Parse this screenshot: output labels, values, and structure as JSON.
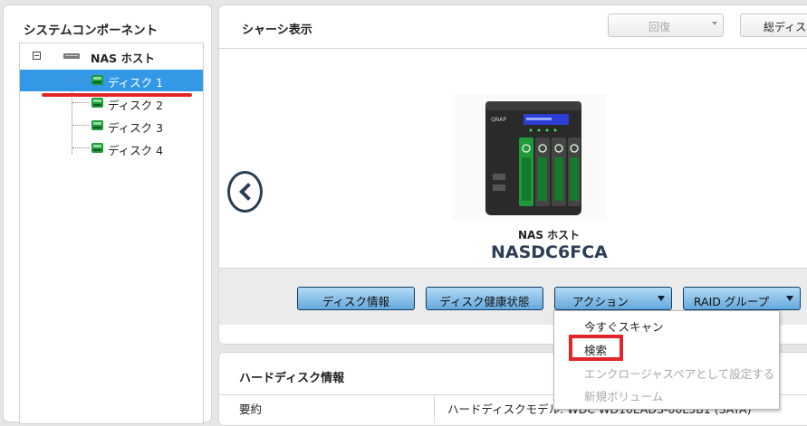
{
  "left_panel": {
    "title": "システムコンポーネント",
    "tree": {
      "root_label": "NAS ホスト",
      "items": [
        {
          "label": "ディスク 1",
          "selected": true
        },
        {
          "label": "ディスク 2",
          "selected": false
        },
        {
          "label": "ディスク 3",
          "selected": false
        },
        {
          "label": "ディスク 4",
          "selected": false
        }
      ]
    }
  },
  "chassis": {
    "title": "シャーシ表示",
    "restore_label": "回復",
    "total_label": "総ディスク",
    "nas_caption": "NAS ホスト",
    "nas_name": "NASDC6FCA"
  },
  "actions": {
    "disk_info": "ディスク情報",
    "disk_health": "ディスク健康状態",
    "action": "アクション",
    "raid_group": "RAID グループ"
  },
  "action_menu": {
    "items": [
      {
        "label": "今すぐスキャン",
        "enabled": true
      },
      {
        "label": "検索",
        "enabled": true,
        "highlighted": true
      },
      {
        "label": "エンクロージャスペアとして設定する",
        "enabled": false
      },
      {
        "label": "新規ボリューム",
        "enabled": false
      }
    ]
  },
  "hdd_info": {
    "title": "ハードディスク情報",
    "summary_label": "要約",
    "summary_value": "ハードディスクモデル: WDC WD10EADS-00L5B1 (SATA)"
  },
  "colors": {
    "selection": "#3399e6",
    "accent_red": "#e2252b",
    "button_blue": "#64a8dc",
    "disk_green": "#1f9a3a"
  },
  "icons": [
    "collapse-icon",
    "nas-host-icon",
    "disk-icon",
    "chevron-left-icon",
    "dropdown-caret-icon"
  ]
}
